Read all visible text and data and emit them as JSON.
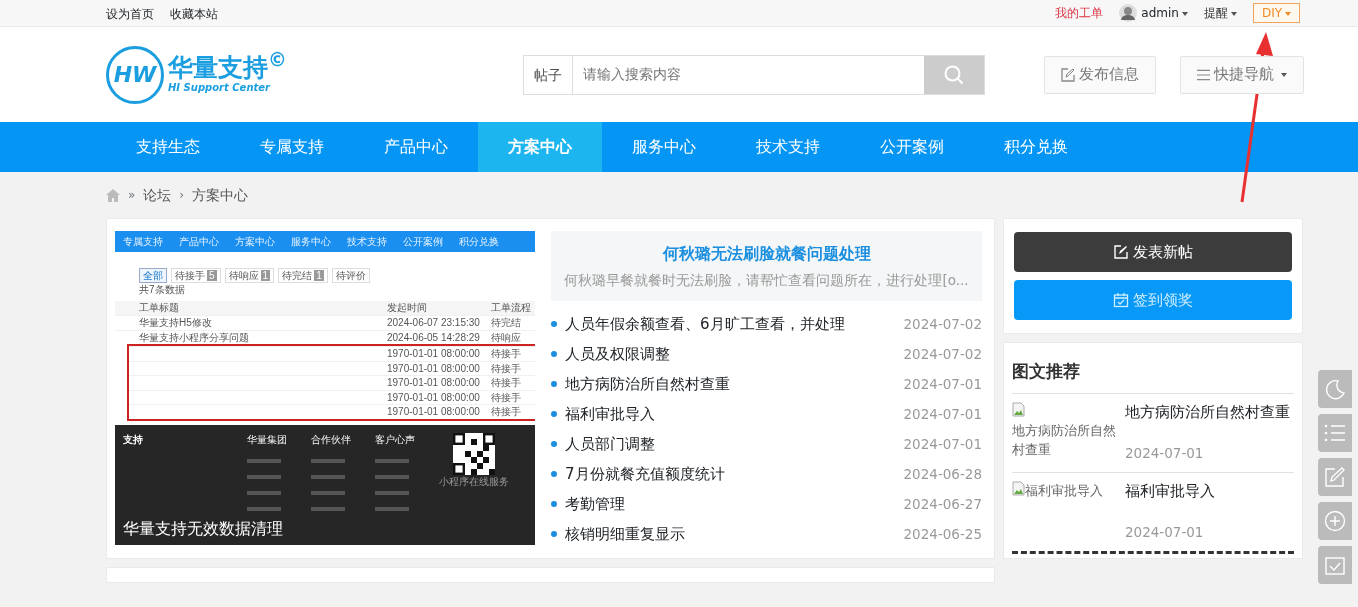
{
  "top_bar": {
    "links": [
      "设为首页",
      "收藏本站"
    ],
    "my_orders": "我的工单",
    "user": "admin",
    "reminders": "提醒",
    "diy": "DIY"
  },
  "header": {
    "logo": {
      "mark": "HW",
      "name": "华量支持",
      "sup": "©",
      "subtitle": "HI Support Center"
    },
    "search": {
      "scope": "帖子",
      "placeholder": "请输入搜索内容"
    },
    "publish": "发布信息",
    "quick_nav": "快捷导航"
  },
  "nav": [
    {
      "label": "支持生态",
      "selected": false
    },
    {
      "label": "专属支持",
      "selected": false
    },
    {
      "label": "产品中心",
      "selected": false
    },
    {
      "label": "方案中心",
      "selected": true
    },
    {
      "label": "服务中心",
      "selected": false
    },
    {
      "label": "技术支持",
      "selected": false
    },
    {
      "label": "公开案例",
      "selected": false
    },
    {
      "label": "积分兑换",
      "selected": false
    }
  ],
  "breadcrumb": [
    {
      "separator": "»",
      "label": "论坛"
    },
    {
      "separator": "›",
      "label": "方案中心"
    }
  ],
  "slide": {
    "nav": [
      "专属支持",
      "产品中心",
      "方案中心",
      "服务中心",
      "技术支持",
      "公开案例",
      "积分兑换"
    ],
    "tabs": [
      {
        "label": "全部",
        "selected": true
      },
      {
        "label": "待接手",
        "count": "5",
        "selected": false
      },
      {
        "label": "待响应",
        "count": "1",
        "selected": false
      },
      {
        "label": "待完结",
        "count": "1",
        "selected": false
      },
      {
        "label": "待评价",
        "selected": false
      }
    ],
    "total": "共7条数据",
    "columns": [
      "工单标题",
      "发起时间",
      "工单流程"
    ],
    "rows": [
      {
        "title": "华量支持H5修改",
        "time": "2024-06-07 23:15:30",
        "flow": "待完结",
        "highlighted": false
      },
      {
        "title": "华量支持小程序分享问题",
        "time": "2024-06-05 14:28:29",
        "flow": "待响应",
        "highlighted": false
      },
      {
        "title": "",
        "time": "1970-01-01 08:00:00",
        "flow": "待接手",
        "highlighted": true
      },
      {
        "title": "",
        "time": "1970-01-01 08:00:00",
        "flow": "待接手",
        "highlighted": true
      },
      {
        "title": "",
        "time": "1970-01-01 08:00:00",
        "flow": "待接手",
        "highlighted": true
      },
      {
        "title": "",
        "time": "1970-01-01 08:00:00",
        "flow": "待接手",
        "highlighted": true
      },
      {
        "title": "",
        "time": "1970-01-01 08:00:00",
        "flow": "待接手",
        "highlighted": true
      }
    ],
    "footer_brand": "支持",
    "footer_columns": [
      "华量集团",
      "合作伙伴",
      "客户心声"
    ],
    "qr_caption": "小程序在线服务",
    "caption": "华量支持无效数据清理"
  },
  "featured": {
    "title": "何秋璐无法刷脸就餐问题处理",
    "summary": "何秋璐早餐就餐时无法刷脸，请帮忙查看问题所在，进行处理[o..."
  },
  "threads": [
    {
      "title": "人员年假余额查看、6月旷工查看，并处理",
      "date": "2024-07-02"
    },
    {
      "title": "人员及权限调整",
      "date": "2024-07-02"
    },
    {
      "title": "地方病防治所自然村查重",
      "date": "2024-07-01"
    },
    {
      "title": "福利审批导入",
      "date": "2024-07-01"
    },
    {
      "title": "人员部门调整",
      "date": "2024-07-01"
    },
    {
      "title": "7月份就餐充值额度统计",
      "date": "2024-06-28"
    },
    {
      "title": "考勤管理",
      "date": "2024-06-27"
    },
    {
      "title": "核销明细重复显示",
      "date": "2024-06-25"
    }
  ],
  "sidebar": {
    "buttons": [
      {
        "kind": "post",
        "label": "发表新帖"
      },
      {
        "kind": "sign",
        "label": "签到领奖"
      }
    ],
    "recommend": {
      "title": "图文推荐",
      "items": [
        {
          "alt": "地方病防治所自然村查重",
          "title": "地方病防治所自然村查重",
          "date": "2024-07-01"
        },
        {
          "alt": "福利审批导入",
          "title": "福利审批导入",
          "date": "2024-07-01"
        }
      ]
    }
  },
  "float_tools": [
    {
      "kind": "moon"
    },
    {
      "kind": "list"
    },
    {
      "kind": "edit"
    },
    {
      "kind": "plus"
    },
    {
      "kind": "check"
    }
  ]
}
